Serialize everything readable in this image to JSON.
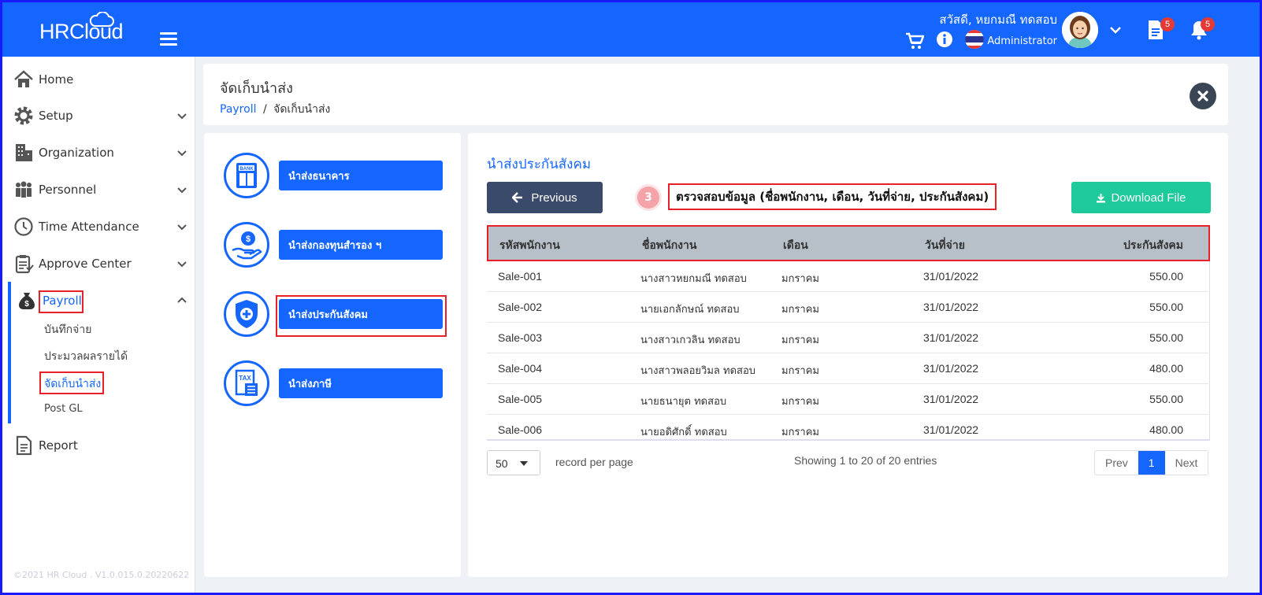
{
  "topbar": {
    "logo": "HRCloud",
    "greeting": "สวัสดี, หยกมณี ทดสอบ",
    "role": "Administrator",
    "doc_badge": "5",
    "bell_badge": "5",
    "accent": "#1565ff"
  },
  "sidebar": {
    "items": [
      {
        "label": "Home",
        "icon": "home-icon"
      },
      {
        "label": "Setup",
        "icon": "gear-icon"
      },
      {
        "label": "Organization",
        "icon": "building-icon"
      },
      {
        "label": "Personnel",
        "icon": "people-icon"
      },
      {
        "label": "Time Attendance",
        "icon": "clock-icon"
      },
      {
        "label": "Approve Center",
        "icon": "clipboard-icon"
      },
      {
        "label": "Payroll",
        "icon": "money-bag-icon"
      },
      {
        "label": "Report",
        "icon": "document-icon"
      }
    ],
    "payroll_sub": [
      "บันทึกจ่าย",
      "ประมวลผลรายได้",
      "จัดเก็บนำส่ง",
      "Post GL"
    ],
    "footer": "©2021 HR Cloud . V1.0.015.0.20220622"
  },
  "header": {
    "title": "จัดเก็บนำส่ง",
    "breadcrumb_link": "Payroll",
    "breadcrumb_sep": "/",
    "breadcrumb_current": "จัดเก็บนำส่ง"
  },
  "menu": {
    "items": [
      {
        "label": "นำส่งธนาคาร",
        "icon": "bank-icon"
      },
      {
        "label": "นำส่งกองทุนสำรอง ฯ",
        "icon": "fund-hand-icon"
      },
      {
        "label": "นำส่งประกันสังคม",
        "icon": "shield-plus-icon"
      },
      {
        "label": "นำส่งภาษี",
        "icon": "tax-icon"
      }
    ]
  },
  "main": {
    "section_title": "นำส่งประกันสังคม",
    "previous_label": "Previous",
    "step_number": "3",
    "step_text": "ตรวจสอบข้อมูล (ชื่อพนักงาน, เดือน, วันที่จ่าย, ประกันสังคม)",
    "download_label": "Download File",
    "columns": [
      "รหัสพนักงาน",
      "ชื่อพนักงาน",
      "เดือน",
      "วันที่จ่าย",
      "ประกันสังคม"
    ],
    "rows": [
      {
        "id": "Sale-001",
        "name": "นางสาวหยกมณี ทดสอบ",
        "month": "มกราคม",
        "date": "31/01/2022",
        "amount": "550.00"
      },
      {
        "id": "Sale-002",
        "name": "นายเอกลักษณ์ ทดสอบ",
        "month": "มกราคม",
        "date": "31/01/2022",
        "amount": "550.00"
      },
      {
        "id": "Sale-003",
        "name": "นางสาวเกวลิน ทดสอบ",
        "month": "มกราคม",
        "date": "31/01/2022",
        "amount": "550.00"
      },
      {
        "id": "Sale-004",
        "name": "นางสาวพลอยวิมล ทดสอบ",
        "month": "มกราคม",
        "date": "31/01/2022",
        "amount": "480.00"
      },
      {
        "id": "Sale-005",
        "name": "นายธนายุต ทดสอบ",
        "month": "มกราคม",
        "date": "31/01/2022",
        "amount": "550.00"
      },
      {
        "id": "Sale-006",
        "name": "นายอดิศักดิ์ ทดสอบ",
        "month": "มกราคม",
        "date": "31/01/2022",
        "amount": "480.00"
      }
    ],
    "per_page": "50",
    "per_page_label": "record per page",
    "showing": "Showing 1 to 20 of 20 entries",
    "pager": {
      "prev": "Prev",
      "current": "1",
      "next": "Next"
    }
  }
}
